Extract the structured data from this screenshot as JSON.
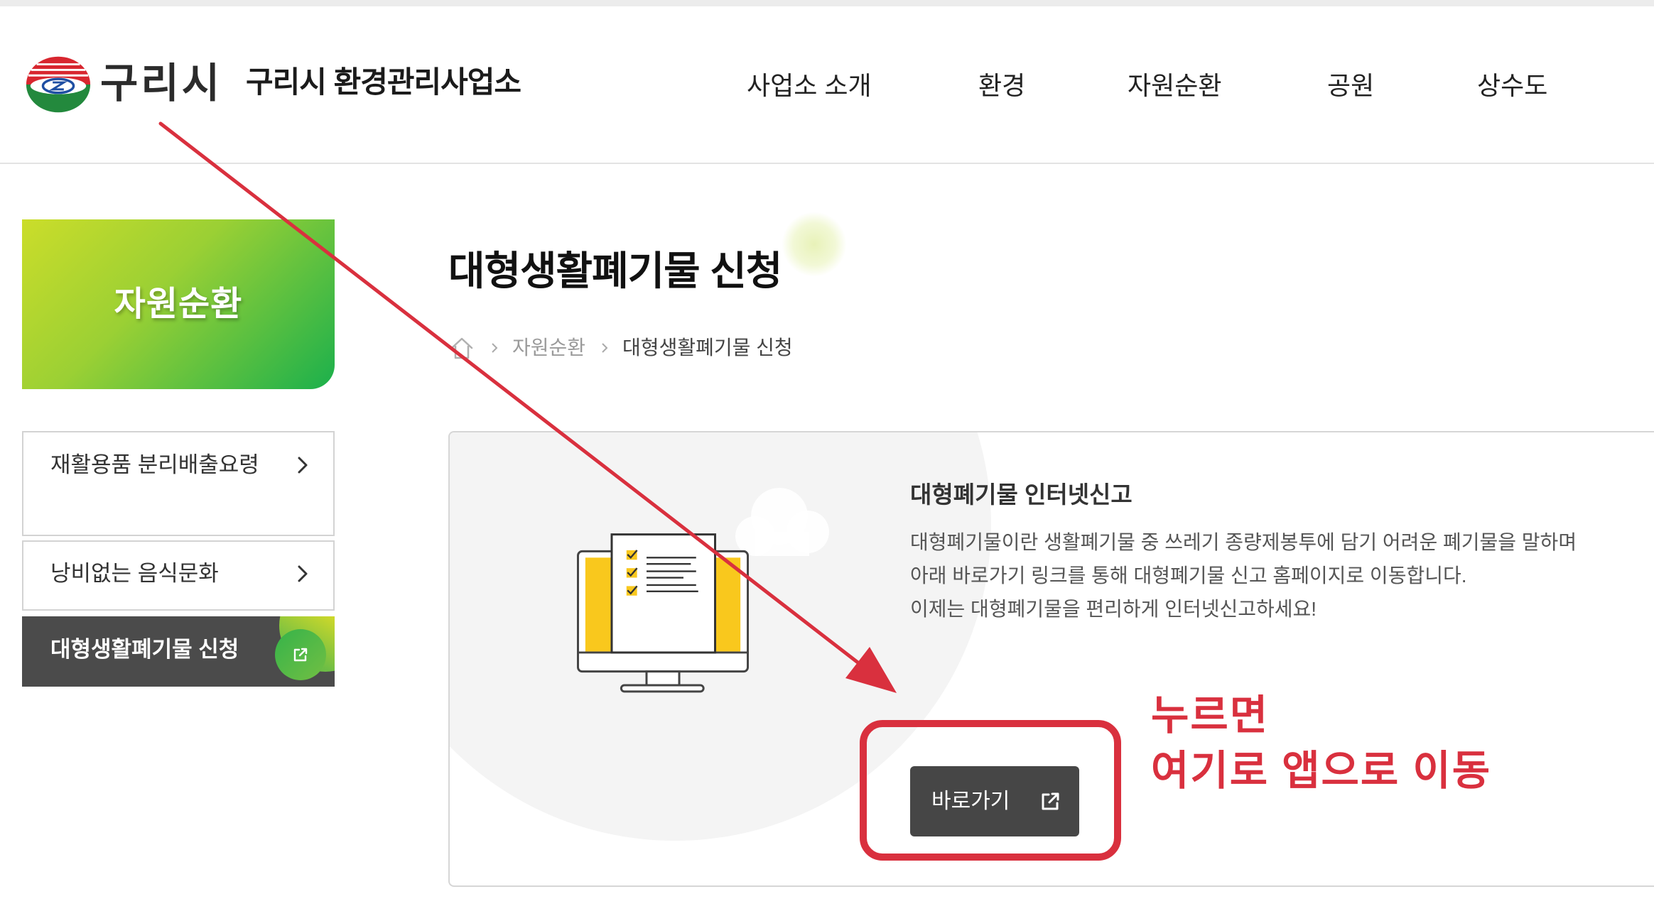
{
  "header": {
    "logo_icon": "guri-city-emblem-icon",
    "logo_text": "구리시",
    "site_title": "구리시 환경관리사업소",
    "nav": [
      {
        "label": "사업소 소개"
      },
      {
        "label": "환경"
      },
      {
        "label": "자원순환"
      },
      {
        "label": "공원"
      },
      {
        "label": "상수도"
      }
    ]
  },
  "sidebar": {
    "banner_title": "자원순환",
    "items": [
      {
        "label": "재활용품 분리배출요령",
        "icon": "chevron-right-icon",
        "active": false
      },
      {
        "label": "낭비없는 음식문화",
        "icon": "chevron-right-icon",
        "active": false
      },
      {
        "label": "대형생활폐기물 신청",
        "icon": "external-link-icon",
        "active": true
      }
    ]
  },
  "main": {
    "page_title": "대형생활폐기물 신청",
    "breadcrumb": {
      "home_icon": "home-icon",
      "separator_icon": "chevron-right-icon",
      "items": [
        "자원순환",
        "대형생활폐기물 신청"
      ]
    },
    "card": {
      "illustration_icon": "monitor-checklist-icon",
      "heading": "대형폐기물 인터넷신고",
      "description": [
        "대형폐기물이란 생활폐기물 중 쓰레기 종량제봉투에 담기 어려운 폐기물을 말하며",
        "아래 바로가기 링크를 통해 대형폐기물 신고 홈페이지로 이동합니다.",
        "이제는 대형폐기물을 편리하게 인터넷신고하세요!"
      ],
      "button_label": "바로가기",
      "button_icon": "external-link-icon"
    }
  },
  "annotation": {
    "lines": [
      "누르면",
      "여기로 앱으로 이동"
    ],
    "arrow_icon": "arrow-icon"
  },
  "colors": {
    "brand_green": "#1bb04c",
    "brand_yellow_green": "#cbdd2a",
    "illustration_yellow": "#f9c81d",
    "active_menu_bg": "#4b4b4b",
    "button_bg": "#464646",
    "annotation_red": "#d9303e"
  }
}
